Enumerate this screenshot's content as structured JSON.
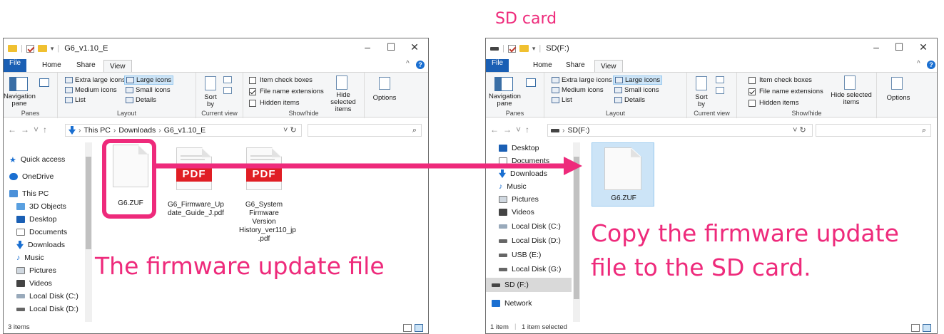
{
  "sd_card_label": "SD card",
  "caption_left": "The firmware update file",
  "caption_right_line1": "Copy the firmware update",
  "caption_right_line2": "file to the SD card.",
  "accent_color": "#ee2a7b",
  "left_window": {
    "title": "G6_v1.10_E",
    "tabs": [
      "File",
      "Home",
      "Share",
      "View"
    ],
    "ribbon": {
      "nav_pane": "Navigation pane",
      "panes_label": "Panes",
      "layout_items": [
        "Extra large icons",
        "Large icons",
        "Medium icons",
        "Small icons",
        "List",
        "Details"
      ],
      "layout_label": "Layout",
      "sort_label": "Sort by",
      "current_view_label": "Current view",
      "item_check_boxes": "Item check boxes",
      "file_name_extensions": "File name extensions",
      "hidden_items": "Hidden items",
      "hide_selected": "Hide selected items",
      "show_hide_label": "Show/hide",
      "options": "Options"
    },
    "breadcrumb": [
      "This PC",
      "Downloads",
      "G6_v1.10_E"
    ],
    "nav_items": [
      "Quick access",
      "OneDrive",
      "This PC",
      "3D Objects",
      "Desktop",
      "Documents",
      "Downloads",
      "Music",
      "Pictures",
      "Videos",
      "Local Disk (C:)",
      "Local Disk (D:)"
    ],
    "files": [
      {
        "name": "G6.ZUF",
        "type": "file"
      },
      {
        "name": "G6_Firmware_Up date_Guide_J.pdf",
        "type": "pdf"
      },
      {
        "name": "G6_System Firmware Version History_ver110_jp .pdf",
        "type": "pdf"
      }
    ],
    "pdf_badge": "PDF",
    "status": "3 items"
  },
  "right_window": {
    "title": "SD(F:)",
    "tabs": [
      "File",
      "Home",
      "Share",
      "View"
    ],
    "ribbon": {
      "nav_pane": "Navigation pane",
      "panes_label": "Panes",
      "layout_items": [
        "Extra large icons",
        "Large icons",
        "Medium icons",
        "Small icons",
        "List",
        "Details"
      ],
      "layout_label": "Layout",
      "sort_label": "Sort by",
      "current_view_label": "Current view",
      "item_check_boxes": "Item check boxes",
      "file_name_extensions": "File name extensions",
      "hidden_items": "Hidden items",
      "hide_selected": "Hide selected items",
      "show_hide_label": "Show/hide",
      "options": "Options"
    },
    "breadcrumb": [
      "SD(F:)"
    ],
    "nav_items": [
      "Desktop",
      "Documents",
      "Downloads",
      "Music",
      "Pictures",
      "Videos",
      "Local Disk (C:)",
      "Local Disk (D:)",
      "USB (E:)",
      "Local Disk (G:)",
      "SD (F:)",
      "Network"
    ],
    "files": [
      {
        "name": "G6.ZUF",
        "type": "file"
      }
    ],
    "status_items": "1 item",
    "status_selected": "1 item selected"
  }
}
